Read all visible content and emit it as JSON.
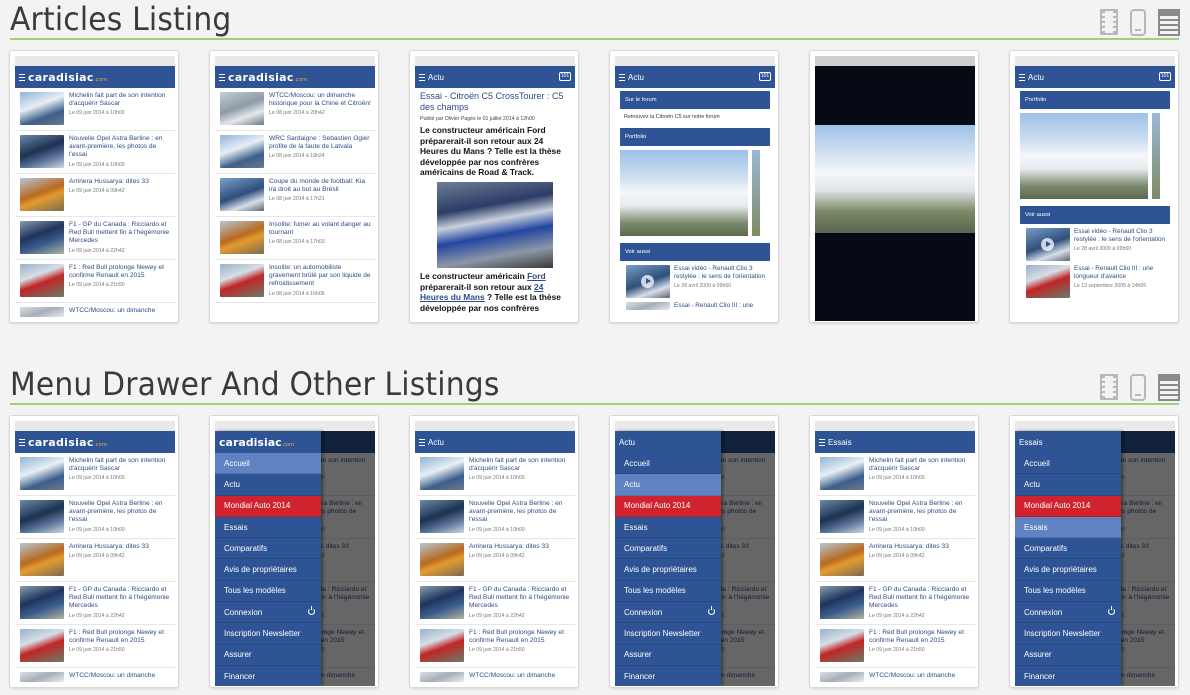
{
  "sections": [
    {
      "title": "Articles Listing"
    },
    {
      "title": "Menu Drawer And Other Listings"
    }
  ],
  "view_icons": [
    "film-strip-icon",
    "phone-icon",
    "tablet-icon"
  ],
  "colors": {
    "brand": "#2f5496",
    "accent_line": "#9ed17e",
    "menu_highlight": "#d0232d",
    "menu_selected": "#5f83c2",
    "logo_suffix": "#f3b23b"
  },
  "app": {
    "logo": "caradisiac",
    "logo_suffix": ".com",
    "actu": "Actu",
    "essais": "Essais",
    "comment_badge": "101"
  },
  "articles": [
    {
      "title": "Michelin fait part de son intention d'acquérir Sascar",
      "date": "Le 09 juin 2014 à 10h00"
    },
    {
      "title": "Nouvelle Opel Astra Berline : en avant-première, les photos de l'essai",
      "date": "Le 09 juin 2014 à 10h00"
    },
    {
      "title": "Arrinera Hussarya: dites 33",
      "date": "Le 09 juin 2014 à 09h42"
    },
    {
      "title": "F1 - GP du Canada : Ricciardo et Red Bull mettent fin à l'hégémonie Mercedes",
      "date": "Le 09 juin 2014 à 22h42"
    },
    {
      "title": "F1 : Red Bull prolonge Newey et confirme Renault en 2015",
      "date": "Le 09 juin 2014 à 21h50"
    },
    {
      "title": "WTCC/Moscou: un dimanche"
    }
  ],
  "articles_second": [
    {
      "title": "WTCC/Moscou: un dimanche historique pour la Chine et Citroën!",
      "date": "Le 08 juin 2014 à 20h42"
    },
    {
      "title": "WRC Sardaigne : Sebastien Ogier profite de la faute de Latvala",
      "date": "Le 08 juin 2014 à 19h24"
    },
    {
      "title": "Coupe du monde de football: Kia ira droit au but au Brésil",
      "date": "Le 08 juin 2014 à 17h21"
    },
    {
      "title": "Insolite: fumer au volant danger au tournant",
      "date": "Le 08 juin 2014 à 17h03"
    },
    {
      "title": "Insolite: un automobiliste gravement brûlé par son liquide de refroidissement",
      "date": "Le 08 juin 2014 à 16h06"
    }
  ],
  "article_detail": {
    "title": "Essai - Citroën C5 CrossTourer : C5 des champs",
    "meta": "Publié par Olivier Pagès le 01 juillet 2014 à 12h00",
    "lead": "Le constructeur américain Ford préparerait-il son retour aux 24 Heures du Mans ? Telle est la thèse développée par nos confrères américains de Road & Track.",
    "body_start": "Le constructeur américain ",
    "body_link1": "Ford",
    "body_mid": " préparerait-il son retour aux ",
    "body_link2": "24 Heures du Mans",
    "body_end": " ? Telle est la thèse développée par nos confrères"
  },
  "forum": {
    "section_forum": "Sur le forum",
    "forum_text": "Retrouvez la Citroën C5 sur notre forum",
    "section_portfolio": "Portfolio",
    "section_voir": "Voir aussi",
    "related": [
      {
        "title": "Essai vidéo - Renault Clio 3 restylée : le sens de l'orientation",
        "date": "Le 28 avril 2009 à 09h50"
      },
      {
        "title": "Essai - Renault Clio III : une longueur d'avance",
        "date": "Le 13 septembre 2005 à 14h05"
      }
    ],
    "related_cut": "Essai - Renault Clio III : une"
  },
  "menu": [
    "Accueil",
    "Actu",
    "Mondial Auto 2014",
    "Essais",
    "Comparatifs",
    "Avis de propriétaires",
    "Tous les modèles",
    "Connexion",
    "Inscription Newsletter",
    "Assurer",
    "Financer"
  ],
  "peek_text": [
    "de son",
    "d'acquérir Sascar",
    "Astra Berline : en",
    "les photos de",
    "dites 33",
    ": Ricciardo et",
    "nt fin à",
    "Mercedes",
    "rolonge Newey et",
    "t en 2015"
  ]
}
